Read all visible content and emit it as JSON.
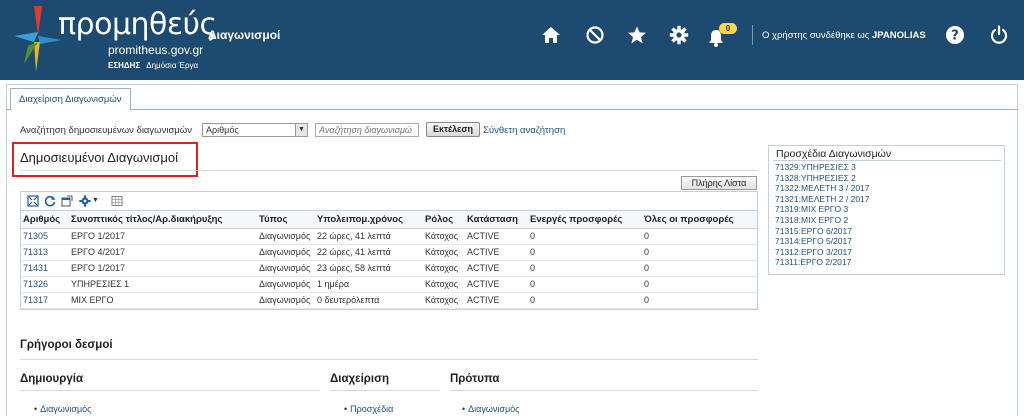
{
  "header": {
    "logo_title": "προμηθεύς",
    "logo_site": "promitheus.gov.gr",
    "logo_org_bold": "ΕΣΗΔΗΣ",
    "logo_org": "Δημόσια Έργα",
    "app_title": "Διαγωνισμοί",
    "notifications_count": "0",
    "user_prefix": "Ο χρήστης συνδέθηκε ως",
    "username": "JPANOLIAS",
    "icons": [
      "home-icon",
      "block-icon",
      "star-icon",
      "gear-icon",
      "bell-icon",
      "help-icon",
      "power-icon"
    ]
  },
  "tabs": [
    {
      "label": "Διαχείριση Διαγωνισμών"
    }
  ],
  "search": {
    "label": "Αναζήτηση δημοσιευμένων διαγωνισμών",
    "field_selected": "Αριθμός",
    "placeholder": "Αναζήτηση διαγωνισμώ",
    "execute_label": "Εκτέλεση",
    "advanced_label": "Σύνθετη αναζήτηση"
  },
  "published": {
    "title": "Δημοσιευμένοι Διαγωνισμοί",
    "full_list_label": "Πλήρης Λίστα",
    "columns": [
      "Αριθμός",
      "Συνοπτικός τίτλος/Αρ.διακήρυξης",
      "Τύπος",
      "Υπολειπομ.χρόνος",
      "Ρόλος",
      "Κατάσταση",
      "Ενεργές προσφορές",
      "Όλες οι προσφορές"
    ],
    "rows": [
      [
        "71305",
        "ΕΡΓΟ 1/2017",
        "Διαγωνισμός",
        "22 ώρες, 41 λεπτά",
        "Κάτοχος",
        "ACTIVE",
        "0",
        "0"
      ],
      [
        "71313",
        "ΕΡΓΟ 4/2017",
        "Διαγωνισμός",
        "22 ώρες, 41 λεπτά",
        "Κάτοχος",
        "ACTIVE",
        "0",
        "0"
      ],
      [
        "71431",
        "ΕΡΓΟ 1/2017",
        "Διαγωνισμός",
        "23 ώρες, 58 λεπτά",
        "Κάτοχος",
        "ACTIVE",
        "0",
        "0"
      ],
      [
        "71326",
        "ΥΠΗΡΕΣΙΕΣ 1",
        "Διαγωνισμός",
        "1 ημέρα",
        "Κάτοχος",
        "ACTIVE",
        "0",
        "0"
      ],
      [
        "71317",
        "ΜΙΧ ΕΡΓΟ",
        "Διαγωνισμός",
        "0 δευτερόλεπτα",
        "Κάτοχος",
        "ACTIVE",
        "0",
        "0"
      ]
    ]
  },
  "drafts": {
    "title": "Προσχέδια Διαγωνισμών",
    "items": [
      "71329:ΥΠΗΡΕΣΙΕΣ 3",
      "71328:ΥΠΗΡΕΣΙΕΣ 2",
      "71322:ΜΕΛΕΤΗ 3 / 2017",
      "71321:ΜΕΛΕΤΗ 2 / 2017",
      "71319:ΜΙΧ ΕΡΓΟ 3",
      "71318:ΜΙΧ ΕΡΓΟ 2",
      "71315:ΕΡΓΟ 6/2017",
      "71314:ΕΡΓΟ 5/2017",
      "71312:ΕΡΓΟ 3/2017",
      "71311:ΕΡΓΟ 2/2017"
    ]
  },
  "quick_links": {
    "title": "Γρήγοροι δεσμοί",
    "columns": [
      {
        "heading": "Δημιουργία",
        "link": "Διαγωνισμός"
      },
      {
        "heading": "Διαχείριση",
        "link": "Προσχέδια"
      },
      {
        "heading": "Πρότυπα",
        "link": "Διαγωνισμός"
      }
    ]
  },
  "colors": {
    "header_bg": "#1d4a70",
    "link": "#21527d",
    "highlight_border": "#dd2222",
    "badge": "#ffd84a"
  }
}
